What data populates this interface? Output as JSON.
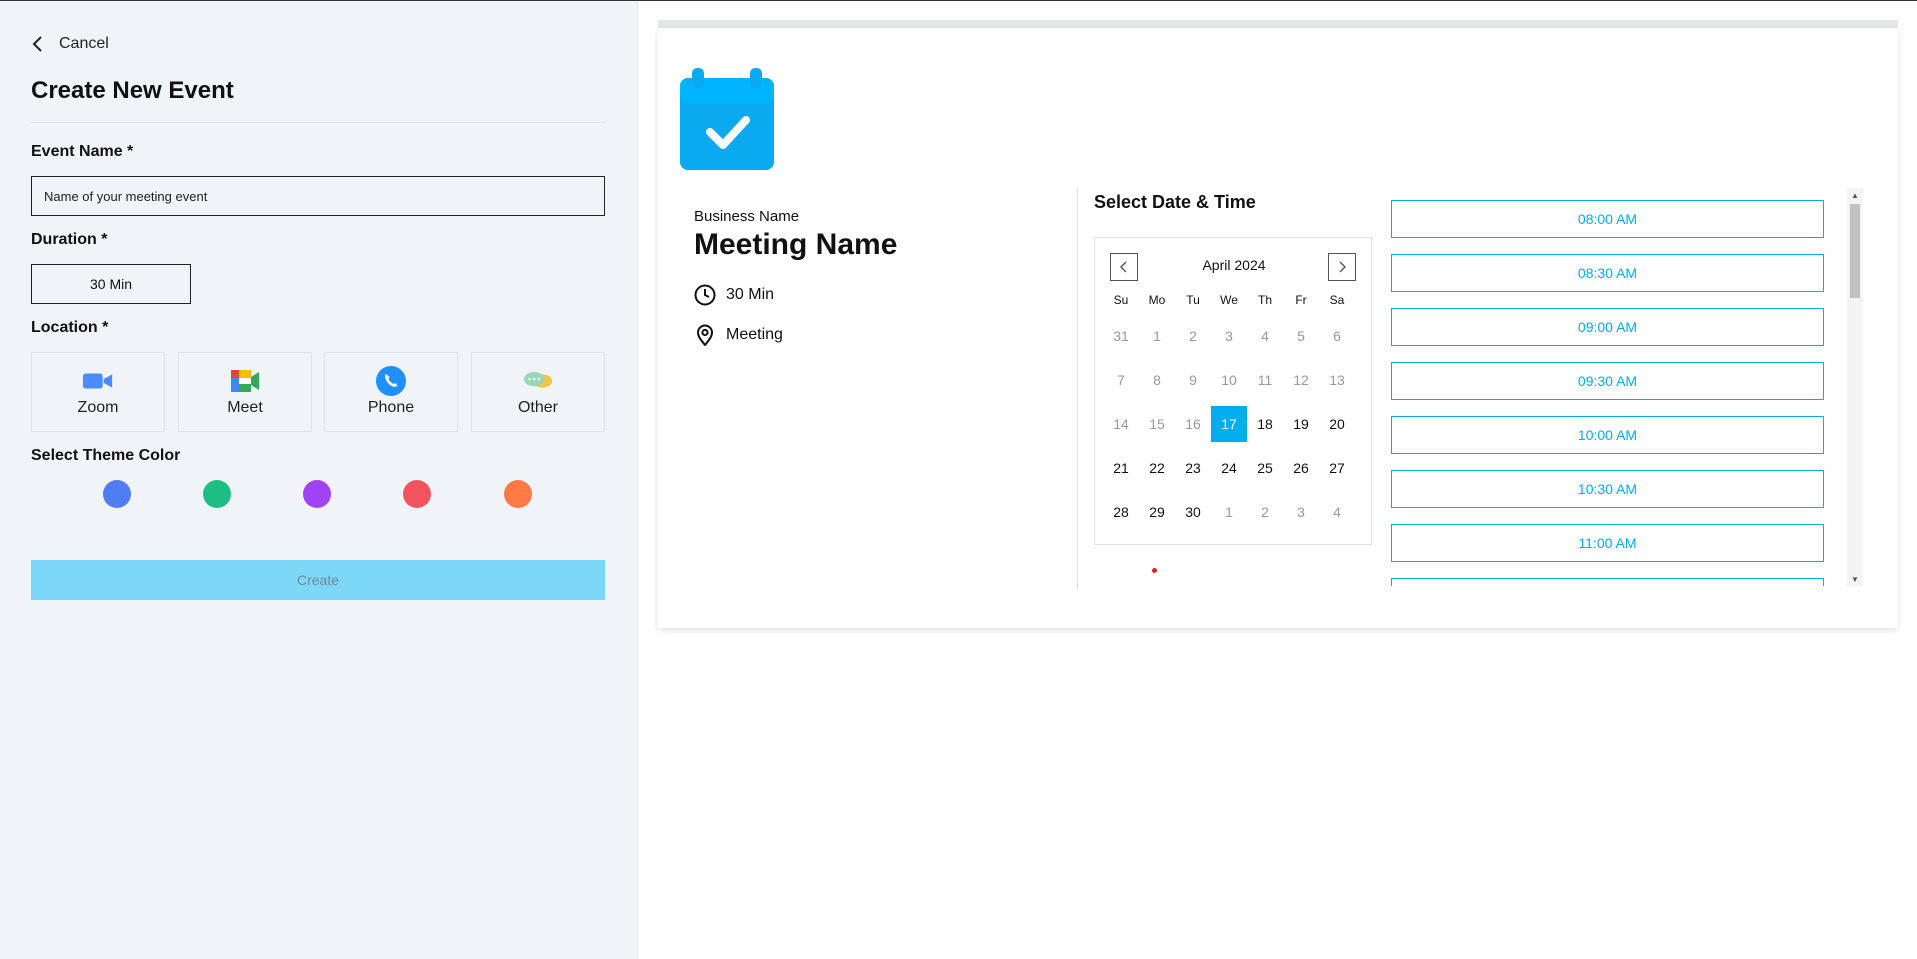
{
  "left_panel": {
    "cancel_label": "Cancel",
    "title": "Create New Event",
    "event_name_label": "Event Name *",
    "event_name_placeholder": "Name of your meeting event",
    "duration_label": "Duration *",
    "duration_value": "30 Min",
    "location_label": "Location *",
    "locations": [
      {
        "label": "Zoom",
        "icon": "zoom-icon"
      },
      {
        "label": "Meet",
        "icon": "google-meet-icon"
      },
      {
        "label": "Phone",
        "icon": "phone-icon"
      },
      {
        "label": "Other",
        "icon": "chat-bubbles-icon"
      }
    ],
    "theme_label": "Select Theme Color",
    "theme_colors": [
      "#4f7df3",
      "#1bbf83",
      "#a142f4",
      "#f4545d",
      "#ff7a45"
    ],
    "create_label": "Create"
  },
  "preview": {
    "business_name": "Business Name",
    "meeting_name": "Meeting Name",
    "duration": "30 Min",
    "location": "Meeting",
    "select_heading": "Select Date & Time",
    "calendar": {
      "month": "April 2024",
      "weekdays": [
        "Su",
        "Mo",
        "Tu",
        "We",
        "Th",
        "Fr",
        "Sa"
      ],
      "weeks": [
        [
          "31",
          "1",
          "2",
          "3",
          "4",
          "5",
          "6"
        ],
        [
          "7",
          "8",
          "9",
          "10",
          "11",
          "12",
          "13"
        ],
        [
          "14",
          "15",
          "16",
          "17",
          "18",
          "19",
          "20"
        ],
        [
          "21",
          "22",
          "23",
          "24",
          "25",
          "26",
          "27"
        ],
        [
          "28",
          "29",
          "30",
          "1",
          "2",
          "3",
          "4"
        ]
      ],
      "selected": "17"
    },
    "time_slots": [
      "08:00 AM",
      "08:30 AM",
      "09:00 AM",
      "09:30 AM",
      "10:00 AM",
      "10:30 AM",
      "11:00 AM"
    ],
    "accent_color": "#00aeef"
  }
}
